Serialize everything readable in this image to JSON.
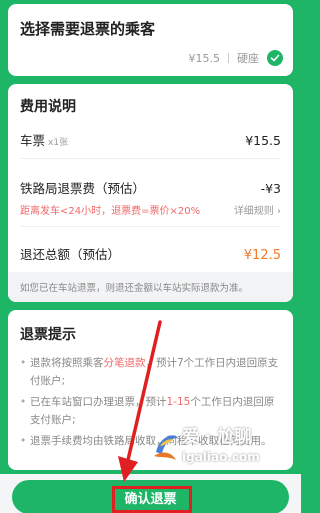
{
  "passenger_section": {
    "title": "选择需要退票的乘客",
    "price": "¥15.5",
    "seat": "硬座",
    "selected_icon": "check-icon"
  },
  "fee_section": {
    "title": "费用说明",
    "ticket_label": "车票",
    "ticket_count": "x1张",
    "ticket_price": "¥15.5",
    "fee_label": "铁路局退票费（预估）",
    "fee_value": "-¥3",
    "fee_rule": "距离发车<24小时，退票费=票价×20%",
    "rule_link": "详细规则",
    "total_label": "退还总额（预估）",
    "total_value": "¥12.5",
    "note": "如您已在车站退票，则退还金额以车站实际退款为准。"
  },
  "tips_section": {
    "title": "退票提示",
    "items": [
      {
        "pre": "退款将按照乘客",
        "highlight": "分笔退款",
        "post": "，预计7个工作日内退回原支付账户;"
      },
      {
        "pre": "已在车站窗口办理退票，预计",
        "highlight": "1-15",
        "post": "个工作日内退回原支付账户;"
      },
      {
        "pre": "退票手续费均由铁路局收取，同程不收取任何费用。",
        "highlight": "",
        "post": ""
      }
    ]
  },
  "confirm_button": {
    "label": "确认退票"
  },
  "watermark": {
    "title": "爱 · 尬聊",
    "url": "igaliao.com"
  },
  "colors": {
    "brand_green": "#1fb567",
    "warning_red": "#f0686a",
    "total_orange": "#f07a2b",
    "annotation_red": "#e02020"
  }
}
